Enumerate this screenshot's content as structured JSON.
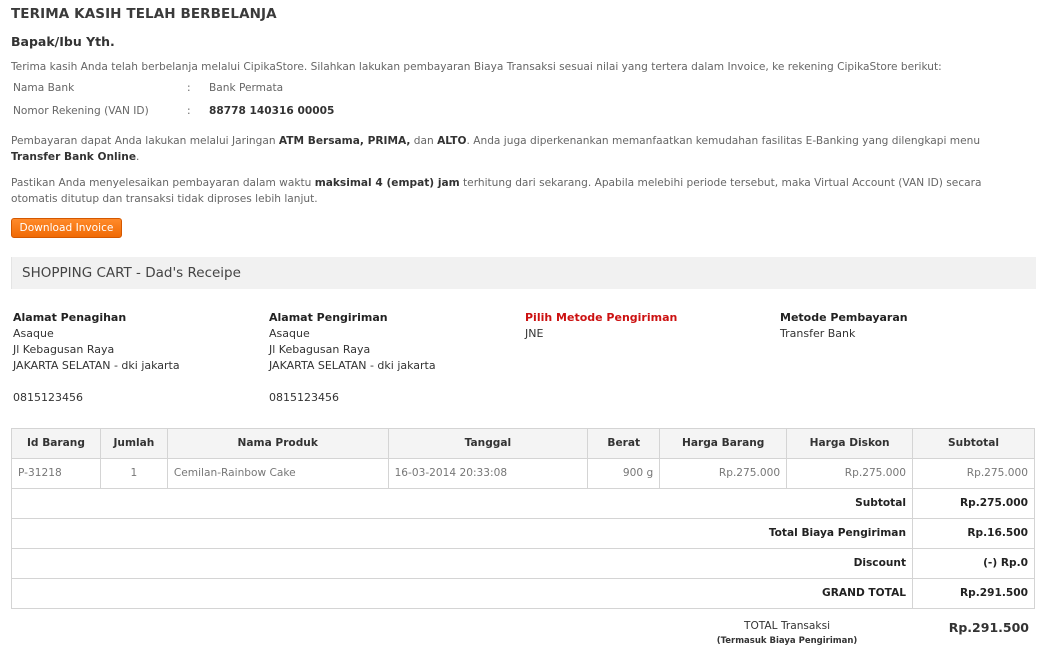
{
  "header": {
    "title": "TERIMA KASIH TELAH BERBELANJA",
    "salutation": "Bapak/Ibu Yth."
  },
  "intro": "Terima kasih Anda telah berbelanja melalui CipikaStore. Silahkan lakukan pembayaran Biaya Transaksi sesuai nilai yang tertera dalam Invoice, ke rekening CipikaStore berikut:",
  "bank": {
    "name_label": "Nama Bank",
    "name_value": "Bank Permata",
    "account_label": "Nomor Rekening (VAN ID)",
    "account_value": "88778 140316 00005",
    "separator": ":"
  },
  "payment_info": {
    "p1_a": "Pembayaran dapat Anda lakukan melalui Jaringan ",
    "p1_b": "ATM Bersama, PRIMA,",
    "p1_c": " dan ",
    "p1_d": "ALTO",
    "p1_e": ". Anda juga diperkenankan memanfaatkan kemudahan fasilitas E-Banking yang dilengkapi menu ",
    "p1_f": "Transfer Bank Online",
    "p1_g": ".",
    "p2_a": "Pastikan Anda menyelesaikan pembayaran dalam waktu ",
    "p2_b": "maksimal 4 (empat) jam",
    "p2_c": " terhitung dari sekarang. Apabila melebihi periode tersebut, maka Virtual Account (VAN ID) secara otomatis ditutup dan transaksi tidak diproses lebih lanjut."
  },
  "download_button": "Download Invoice",
  "cart_title": "SHOPPING CART - Dad's Receipe",
  "addresses": {
    "billing": {
      "heading": "Alamat Penagihan",
      "name": "Asaque",
      "street": "Jl Kebagusan Raya",
      "city": "JAKARTA SELATAN - dki jakarta",
      "phone": "0815123456"
    },
    "shipping": {
      "heading": "Alamat Pengiriman",
      "name": "Asaque",
      "street": "Jl Kebagusan Raya",
      "city": "JAKARTA SELATAN - dki jakarta",
      "phone": "0815123456"
    },
    "shipping_method": {
      "heading": "Pilih Metode Pengiriman",
      "value": "JNE"
    },
    "payment_method": {
      "heading": "Metode Pembayaran",
      "value": "Transfer Bank"
    }
  },
  "table": {
    "headers": [
      "Id Barang",
      "Jumlah",
      "Nama Produk",
      "Tanggal",
      "Berat",
      "Harga Barang",
      "Harga Diskon",
      "Subtotal"
    ],
    "row": {
      "id": "P-31218",
      "qty": "1",
      "product": "Cemilan-Rainbow Cake",
      "date": "16-03-2014 20:33:08",
      "weight": "900 g",
      "price": "Rp.275.000",
      "discount_price": "Rp.275.000",
      "subtotal": "Rp.275.000"
    },
    "summary": [
      {
        "label": "Subtotal",
        "value": "Rp.275.000"
      },
      {
        "label": "Total Biaya Pengiriman",
        "value": "Rp.16.500"
      },
      {
        "label": "Discount",
        "value": "(-) Rp.0"
      },
      {
        "label": "GRAND TOTAL",
        "value": "Rp.291.500"
      }
    ]
  },
  "total": {
    "label": "TOTAL Transaksi",
    "sublabel": "(Termasuk Biaya Pengiriman)",
    "value": "Rp.291.500"
  },
  "colors": {
    "accent": "#f07010",
    "highlight_red": "#cc1111"
  }
}
